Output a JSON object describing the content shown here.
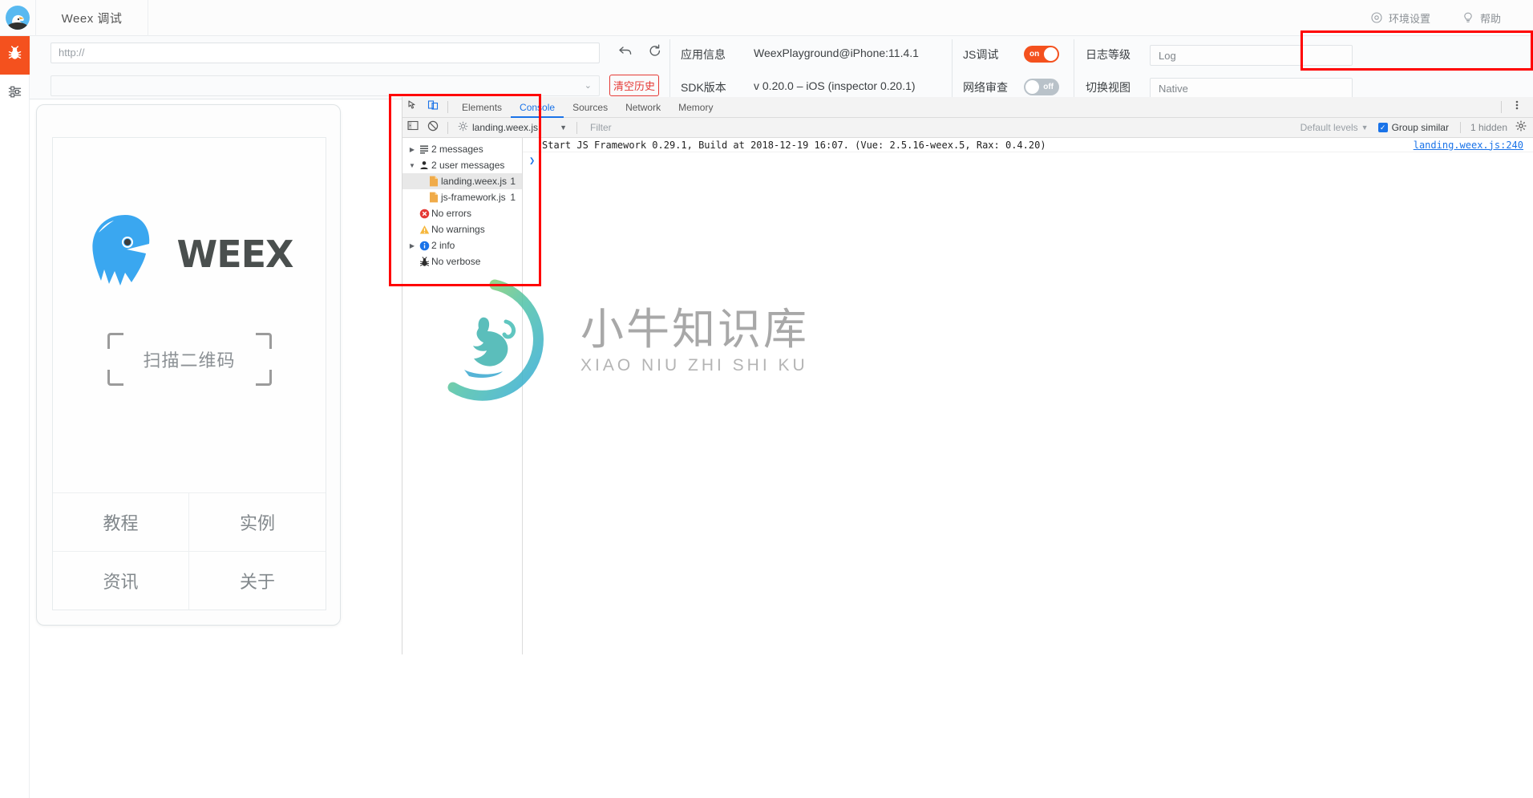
{
  "titlebar": {
    "logo_icon": "weex-eagle-logo",
    "app_title": "Weex 调试",
    "actions": [
      {
        "icon": "settings-circle-icon",
        "label": "环境设置"
      },
      {
        "icon": "lightbulb-help-icon",
        "label": "帮助"
      }
    ]
  },
  "rail": {
    "items": [
      {
        "icon": "bug-icon",
        "name": "debug",
        "active": true
      },
      {
        "icon": "sliders-icon",
        "name": "settings",
        "active": false
      }
    ]
  },
  "toolbar": {
    "url_placeholder": "http://",
    "url_value": "",
    "history_value": "",
    "back_icon": "undo-arrow-icon",
    "reload_icon": "reload-icon",
    "clear_history_label": "清空历史",
    "app_info_label": "应用信息",
    "app_info_value": "WeexPlayground@iPhone:11.4.1",
    "sdk_label": "SDK版本",
    "sdk_value": "v 0.20.0 – iOS (inspector 0.20.1)",
    "js_debug_label": "JS调试",
    "js_debug_state": "on",
    "network_label": "网络审查",
    "network_state": "off",
    "log_level_label": "日志等级",
    "log_level_value": "Log",
    "switch_view_label": "切换视图",
    "switch_view_value": "Native"
  },
  "phone": {
    "brand": "WEEX",
    "logo_icon": "weex-eagle-head-icon",
    "scan_label": "扫描二维码",
    "grid": [
      {
        "label": "教程"
      },
      {
        "label": "实例"
      },
      {
        "label": "资讯"
      },
      {
        "label": "关于"
      }
    ]
  },
  "devtools": {
    "toolbar_icons": [
      {
        "icon": "inspect-element-icon"
      },
      {
        "icon": "device-toolbar-icon"
      }
    ],
    "tabs": [
      {
        "label": "Elements",
        "active": false
      },
      {
        "label": "Console",
        "active": true
      },
      {
        "label": "Sources",
        "active": false
      },
      {
        "label": "Network",
        "active": false
      },
      {
        "label": "Memory",
        "active": false
      }
    ],
    "more_icon": "kebab-menu-icon",
    "filterbar": {
      "sidebar_toggle_icon": "console-sidebar-icon",
      "clear_icon": "clear-console-icon",
      "context_icon": "gear-context-icon",
      "context_value": "landing.weex.js",
      "context_caret": "▼",
      "filter_placeholder": "Filter",
      "levels_label": "Default levels",
      "levels_caret": "▼",
      "group_similar_label": "Group similar",
      "group_similar_checked": true,
      "hidden_label": "1 hidden",
      "settings_icon": "gear-icon"
    },
    "sidebar": [
      {
        "arrow": "▶",
        "icon": "list-icon",
        "label": "2 messages",
        "count": "",
        "selected": false,
        "indent": false
      },
      {
        "arrow": "▼",
        "icon": "user-icon",
        "label": "2 user messages",
        "count": "",
        "selected": false,
        "indent": false
      },
      {
        "arrow": "",
        "icon": "file-js-icon",
        "label": "landing.weex.js",
        "count": "1",
        "selected": true,
        "indent": true
      },
      {
        "arrow": "",
        "icon": "file-js-icon",
        "label": "js-framework.js",
        "count": "1",
        "selected": false,
        "indent": true
      },
      {
        "arrow": "",
        "icon": "error-icon",
        "label": "No errors",
        "count": "",
        "selected": false,
        "indent": false
      },
      {
        "arrow": "",
        "icon": "warning-icon",
        "label": "No warnings",
        "count": "",
        "selected": false,
        "indent": false
      },
      {
        "arrow": "▶",
        "icon": "info-icon",
        "label": "2 info",
        "count": "",
        "selected": false,
        "indent": false
      },
      {
        "arrow": "",
        "icon": "verbose-bug-icon",
        "label": "No verbose",
        "count": "",
        "selected": false,
        "indent": false
      }
    ],
    "messages": [
      {
        "text": "Start JS Framework 0.29.1, Build at 2018-12-19 16:07. (Vue: 2.5.16-weex.5, Rax: 0.4.20)",
        "source": "landing.weex.js:240"
      }
    ],
    "prompt_arrow": "❯"
  },
  "watermark": {
    "cn": "小牛知识库",
    "en": "XIAO NIU ZHI SHI KU",
    "icon": "bull-ring-logo"
  },
  "colors": {
    "accent_orange": "#f4511e",
    "highlight_red": "#ff0000",
    "link_blue": "#1a73e8",
    "weex_blue": "#3aa7f0"
  }
}
